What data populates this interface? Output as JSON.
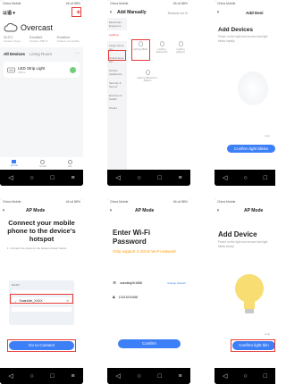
{
  "status": {
    "carrier": "China Mobile",
    "signal": "46 ull 88%",
    "time": "11:23"
  },
  "home": {
    "menu_label": "以语 ▾",
    "add_glyph": "+",
    "weather": "Overcast",
    "stats": [
      {
        "value": "34.0°C",
        "label": "Outdoor Temp"
      },
      {
        "value": "Excellent",
        "label": "Outdoor PM2.5"
      },
      {
        "value": "Excellent",
        "label": "Outdoor Air Quality"
      }
    ],
    "tabs": [
      "All Devices",
      "Living Room"
    ],
    "more_glyph": "···",
    "device_name": "LED Strip Light",
    "device_status": "Offline",
    "nav": [
      "Home",
      "Smart",
      "Me"
    ]
  },
  "add_manual": {
    "title": "Add Manually",
    "search_label": "Search for D",
    "categories": [
      "Electrician Engineers",
      "Lighting",
      "Large Home Ap...",
      "Small Home Ap...",
      "Kitchen Appliances",
      "Security & Sensor",
      "Exercise & Health",
      "Others"
    ],
    "devices": [
      {
        "label": "Lighting (BLE)"
      },
      {
        "label": "Lighting (Bluetooth)"
      },
      {
        "label": "Lighting (Zigbee)"
      },
      {
        "label": "Lighting (Bluetooth + Zigbee)"
      }
    ]
  },
  "add_device_1": {
    "title": "Add Devi",
    "heading": "Add Devices",
    "desc": "Power on the light and ensure that light blinks rapidly.",
    "help": "Help",
    "button": "Confirm light blinks"
  },
  "ap_mode_1": {
    "title": "AP Mode",
    "heading": "Connect your mobile phone to the device's hotspot",
    "step": "1. Connect the phone to the hotspot shown below:",
    "wlan_label": "WLAN",
    "hotspot": "SmartLife_XXXX",
    "button": "Go to Connect"
  },
  "ap_mode_2": {
    "title": "AP Mode",
    "heading": "Enter Wi-Fi Password",
    "warn": "Only support 2.4GHz Wi-Fi network",
    "ssid": "wanding2b1688",
    "change": "Change Network",
    "password": "13213231968",
    "button": "Confirm"
  },
  "add_device_2": {
    "title": "AP Mode",
    "heading": "Add Device",
    "desc": "Power on the light and ensure that light blinks slowly",
    "help": "Help",
    "button": "Confirm light blin"
  },
  "navbar": {
    "back": "◁",
    "home": "○",
    "recent": "□",
    "menu": "≡"
  },
  "colors": {
    "accent": "#3d7ff6",
    "warn": "#ff9800",
    "highlight": "#e53935",
    "bulb": "#f7dd72"
  }
}
